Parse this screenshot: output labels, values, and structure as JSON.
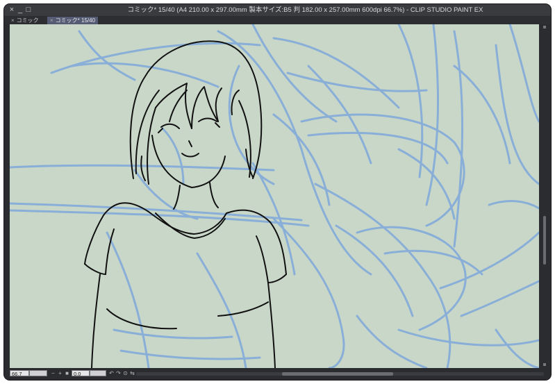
{
  "window": {
    "title": "コミック* 15/40 (A4 210.00 x 297.00mm 製本サイズ:B5 判 182.00 x 257.00mm 600dpi 66.7%)  - CLIP STUDIO PAINT EX",
    "controls": {
      "close": "×",
      "minimize": "_",
      "maximize": "□"
    }
  },
  "tabs": [
    {
      "label": "コミック",
      "close": "×",
      "active": false
    },
    {
      "label": "コミック* 15/40",
      "close": "×",
      "active": true
    }
  ],
  "colors": {
    "canvas": "#c8d7c8",
    "sketch_blue": "#86acd8",
    "lineart": "#111111",
    "chrome": "#2b2c30"
  },
  "status": {
    "zoom": "66.7",
    "rotation": "0.0",
    "icons": [
      "zoom-out-icon",
      "zoom-in-icon",
      "fit-icon",
      "rotate-left-icon",
      "rotate-right-icon",
      "reset-rotation-icon",
      "flip-horizontal-icon"
    ]
  }
}
